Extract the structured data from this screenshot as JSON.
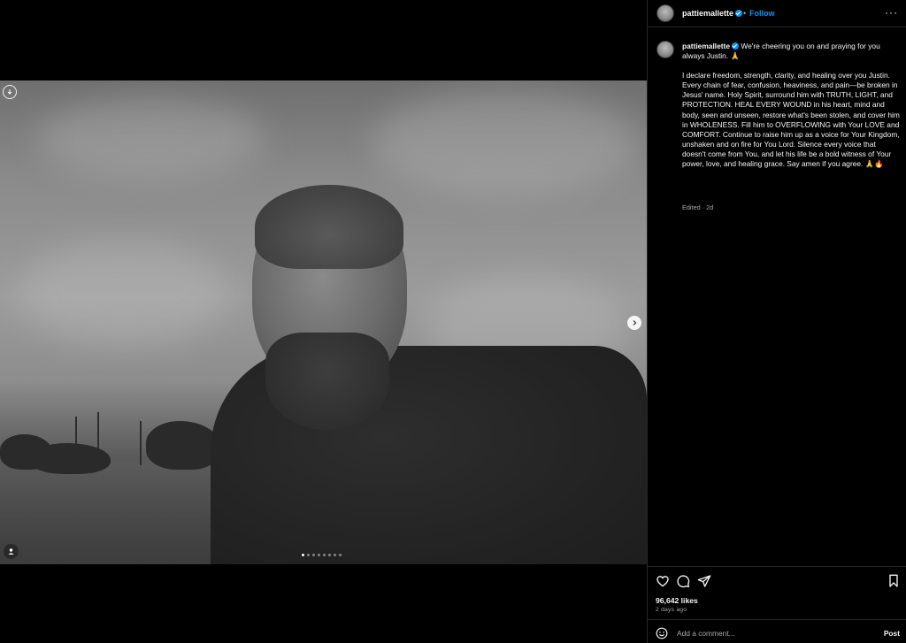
{
  "post": {
    "username": "pattiemallette",
    "verified": true,
    "follow_label": "Follow",
    "bullet": "•",
    "more_label": "···",
    "caption_line1": "We're cheering you on and praying for you always Justin. 🙏",
    "caption_body": "I declare freedom, strength, clarity, and healing over you Justin. Every chain of fear, confusion, heaviness, and pain—be broken in Jesus' name. Holy Spirit, surround him with TRUTH, LIGHT, and PROTECTION. HEAL EVERY WOUND in his heart, mind and body, seen and unseen, restore what's been stolen, and cover him in WHOLENESS. Fill him to OVERFLOWING with Your LOVE and COMFORT. Continue to raise him up as a voice for Your Kingdom, unshaken and on fire for You Lord. Silence every voice that doesn't come from You, and let his life be a bold witness of Your power, love, and healing grace. Say amen if you agree. 🙏🔥",
    "caption_meta": "Edited · 2d",
    "likes": "96,642 likes",
    "time_ago": "2 days ago"
  },
  "carousel": {
    "total_slides": 8,
    "active_index": 0
  },
  "comment_box": {
    "placeholder": "Add a comment...",
    "post_label": "Post"
  },
  "icons": {
    "download": "download-circle-icon",
    "next": "chevron-right-icon",
    "tags": "user-tag-icon",
    "like": "heart-icon",
    "comment": "speech-bubble-icon",
    "share": "paper-plane-icon",
    "save": "bookmark-icon",
    "emoji": "smiley-icon"
  },
  "colors": {
    "background": "#000000",
    "accent": "#0095f6",
    "text": "#f5f5f5",
    "muted": "#a8a8a8",
    "divider": "#262626"
  }
}
